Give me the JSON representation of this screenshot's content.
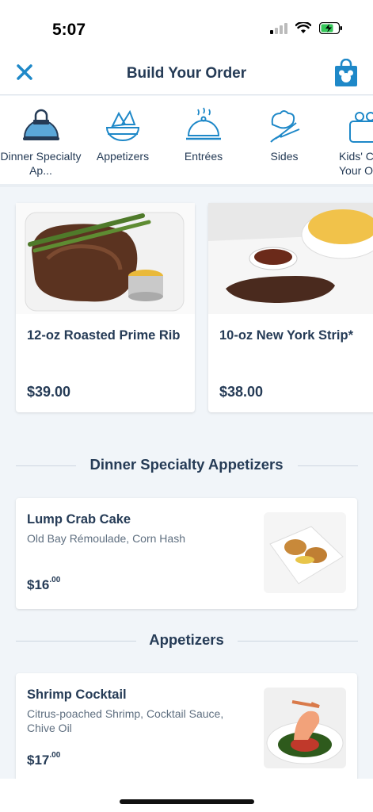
{
  "status": {
    "time": "5:07"
  },
  "header": {
    "title": "Build Your Order"
  },
  "categories": [
    {
      "label": "Dinner Specialty Ap...",
      "icon": "cloche-lock-icon",
      "active": true
    },
    {
      "label": "Appetizers",
      "icon": "appetizer-bowl-icon",
      "active": false
    },
    {
      "label": "Entrées",
      "icon": "serving-cloche-icon",
      "active": false
    },
    {
      "label": "Sides",
      "icon": "vegetables-icon",
      "active": false
    },
    {
      "label": "Kids' Cr... Your O...",
      "icon": "kids-meal-icon",
      "active": false
    }
  ],
  "featured": [
    {
      "name": "12-oz Roasted Prime Rib",
      "price": "$39.00"
    },
    {
      "name": "10-oz New York Strip*",
      "price": "$38.00"
    }
  ],
  "sections": [
    {
      "title": "Dinner Specialty Appetizers",
      "items": [
        {
          "name": "Lump Crab Cake",
          "description": "Old Bay Rémoulade, Corn Hash",
          "price_dollars": "$16",
          "price_cents": ".00"
        }
      ]
    },
    {
      "title": "Appetizers",
      "items": [
        {
          "name": "Shrimp Cocktail",
          "description": "Citrus-poached Shrimp, Cocktail Sauce, Chive Oil",
          "price_dollars": "$17",
          "price_cents": ".00"
        }
      ]
    }
  ],
  "colors": {
    "accent": "#1e88c8",
    "text": "#253b56",
    "background": "#f1f5f9"
  }
}
